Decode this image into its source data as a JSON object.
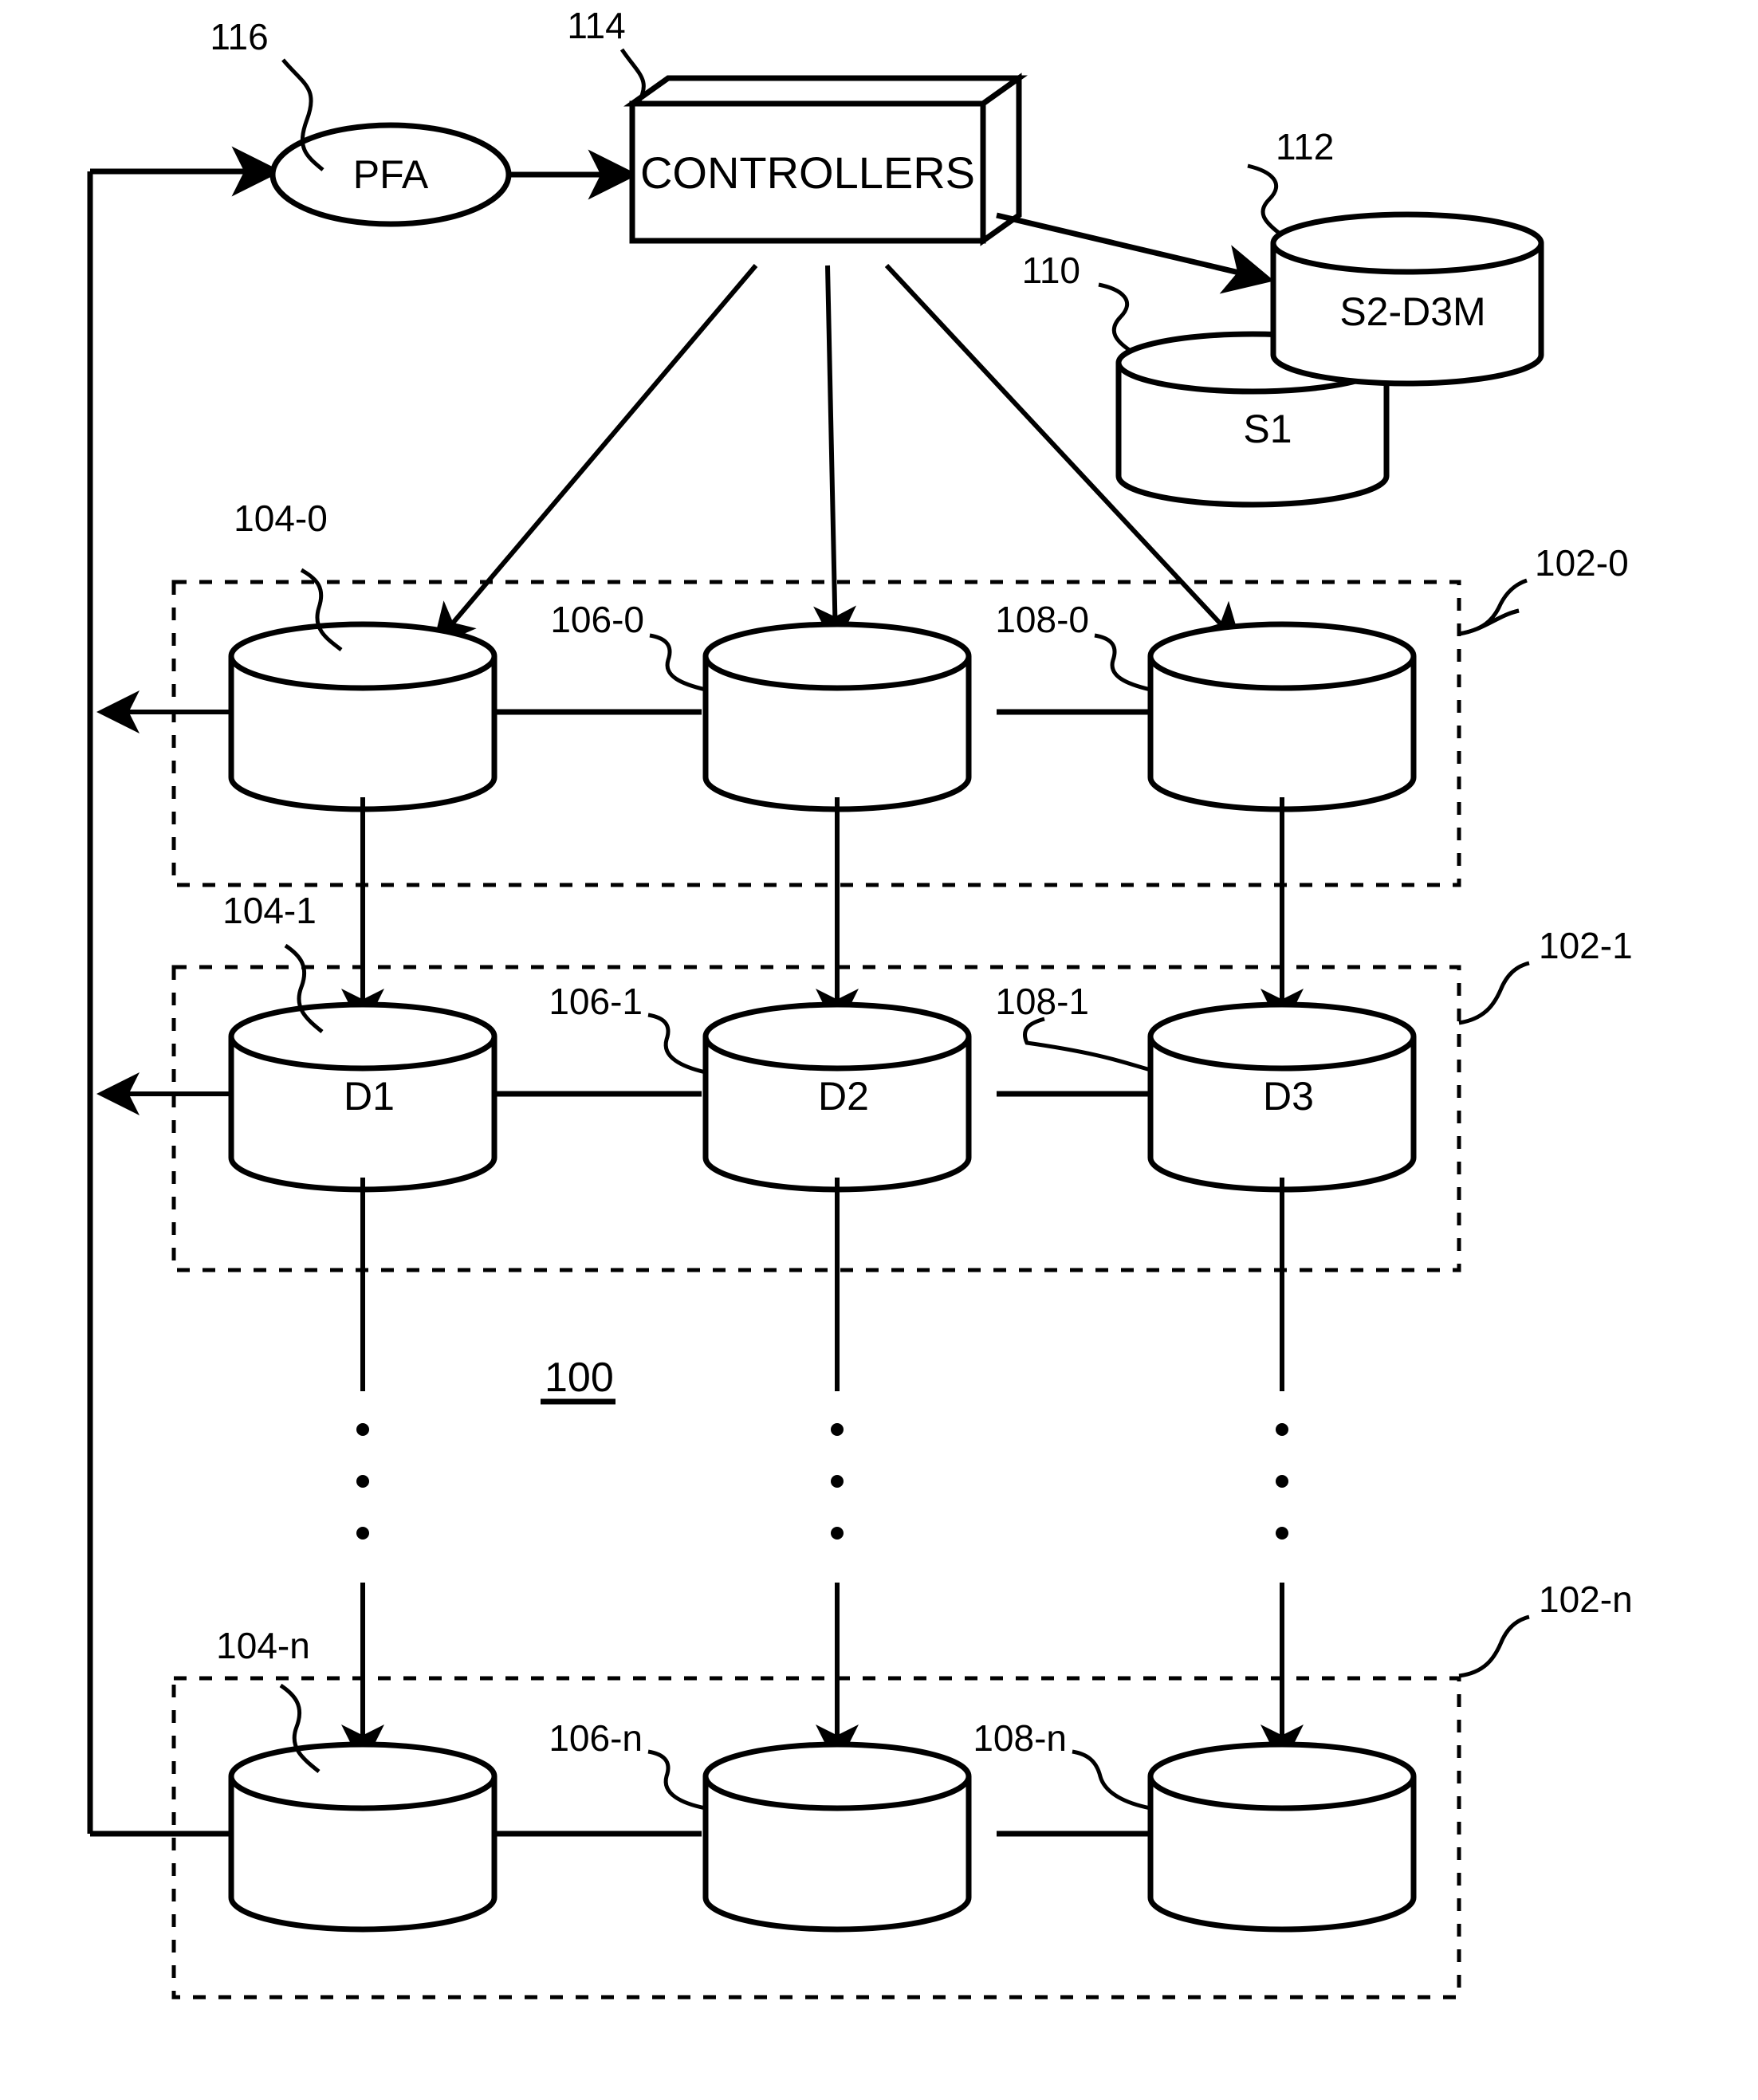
{
  "figure": {
    "title_ref": "100",
    "nodes": {
      "pfa": {
        "label": "PFA",
        "ref": "116"
      },
      "controllers": {
        "label": "CONTROLLERS",
        "ref": "114"
      },
      "s1": {
        "label": "S1",
        "ref": "110"
      },
      "s2d3m": {
        "label": "S2-D3M",
        "ref": "112"
      }
    },
    "rows": [
      {
        "group_ref": "102-0",
        "cells": [
          {
            "ref": "104-0",
            "label": ""
          },
          {
            "ref": "106-0",
            "label": ""
          },
          {
            "ref": "108-0",
            "label": ""
          }
        ]
      },
      {
        "group_ref": "102-1",
        "cells": [
          {
            "ref": "104-1",
            "label": "D1"
          },
          {
            "ref": "106-1",
            "label": "D2"
          },
          {
            "ref": "108-1",
            "label": "D3"
          }
        ]
      },
      {
        "group_ref": "102-n",
        "cells": [
          {
            "ref": "104-n",
            "label": ""
          },
          {
            "ref": "106-n",
            "label": ""
          },
          {
            "ref": "108-n",
            "label": ""
          }
        ]
      }
    ],
    "ellipsis": "vertical-dots"
  }
}
